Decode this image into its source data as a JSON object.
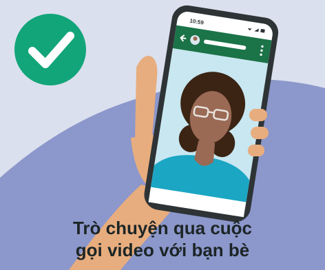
{
  "colors": {
    "background_top": "#dbe0ee",
    "background_curve": "#8c97cb",
    "check_badge": "#12a579",
    "phone_body": "#2e3436",
    "app_bar": "#1b7348",
    "video_background": "#c8e7f1",
    "shirt": "#1ba6c3",
    "skin": "#9a6a55",
    "hair": "#3b2414",
    "hand": "#e8ad7e",
    "caption_text": "#1c2526"
  },
  "phone": {
    "status_time": "10:59",
    "icons": [
      "back-arrow-icon",
      "contact-avatar-icon",
      "more-options-icon",
      "wifi-icon",
      "signal-icon",
      "battery-icon"
    ]
  },
  "badge": {
    "icon": "checkmark-icon"
  },
  "caption": {
    "line1": "Trò chuyện qua cuộc",
    "line2": "gọi video với bạn bè"
  }
}
